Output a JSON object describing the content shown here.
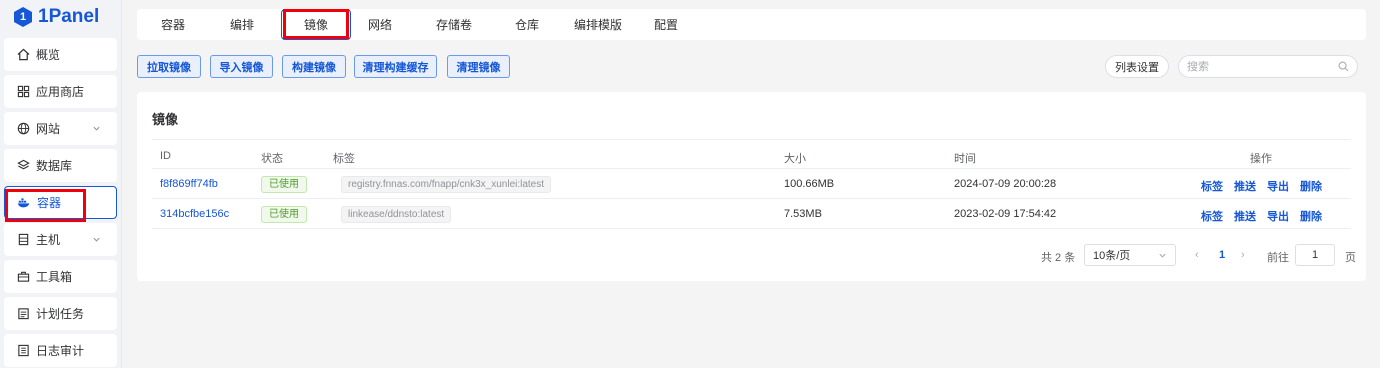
{
  "app": {
    "logo_text": "1Panel",
    "logo_mark": "1"
  },
  "sidebar": {
    "items": [
      {
        "label": "概览",
        "icon": "home-icon"
      },
      {
        "label": "应用商店",
        "icon": "grid-icon"
      },
      {
        "label": "网站",
        "icon": "globe-icon",
        "expandable": true
      },
      {
        "label": "数据库",
        "icon": "layers-icon"
      },
      {
        "label": "容器",
        "icon": "docker-icon",
        "active": true
      },
      {
        "label": "主机",
        "icon": "server-icon",
        "expandable": true
      },
      {
        "label": "工具箱",
        "icon": "toolbox-icon"
      },
      {
        "label": "计划任务",
        "icon": "calendar-icon"
      },
      {
        "label": "日志审计",
        "icon": "log-icon"
      }
    ]
  },
  "tabs": [
    "容器",
    "编排",
    "镜像",
    "网络",
    "存储卷",
    "仓库",
    "编排模版",
    "配置"
  ],
  "active_tab": "镜像",
  "toolbar": {
    "pull": "拉取镜像",
    "import": "导入镜像",
    "build": "构建镜像",
    "prune_build_cache": "清理构建缓存",
    "prune": "清理镜像",
    "columns": "列表设置",
    "search_placeholder": "搜索"
  },
  "card": {
    "title": "镜像",
    "columns": {
      "id": "ID",
      "status": "状态",
      "tags": "标签",
      "size": "大小",
      "time": "时间",
      "ops": "操作"
    },
    "rows": [
      {
        "id": "f8f869ff74fb",
        "status": "已使用",
        "tag": "registry.fnnas.com/fnapp/cnk3x_xunlei:latest",
        "size": "100.66MB",
        "time": "2024-07-09 20:00:28"
      },
      {
        "id": "314bcfbe156c",
        "status": "已使用",
        "tag": "linkease/ddnsto:latest",
        "size": "7.53MB",
        "time": "2023-02-09 17:54:42"
      }
    ],
    "ops": [
      "标签",
      "推送",
      "导出",
      "删除"
    ]
  },
  "pagination": {
    "total_text": "共 2 条",
    "page_size": "10条/页",
    "current_page": "1",
    "goto_label": "前往",
    "goto_value": "1",
    "page_suffix": "页"
  },
  "colors": {
    "accent": "#1557d6",
    "highlight": "#f0000b",
    "success": "#529b2e"
  }
}
